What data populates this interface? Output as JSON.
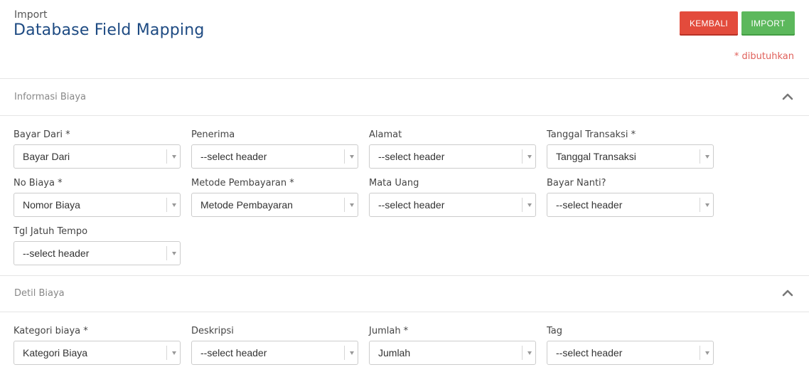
{
  "header": {
    "kicker": "Import",
    "title": "Database Field Mapping",
    "back_label": "KEMBALI",
    "import_label": "IMPORT",
    "required_note": "* dibutuhkan"
  },
  "sections": [
    {
      "title": "Informasi Biaya",
      "fields": [
        {
          "label": "Bayar Dari *",
          "value": "Bayar Dari"
        },
        {
          "label": "Penerima",
          "value": "--select header"
        },
        {
          "label": "Alamat",
          "value": "--select header"
        },
        {
          "label": "Tanggal Transaksi *",
          "value": "Tanggal Transaksi"
        },
        {
          "label": "No Biaya *",
          "value": "Nomor Biaya"
        },
        {
          "label": "Metode Pembayaran *",
          "value": "Metode Pembayaran"
        },
        {
          "label": "Mata Uang",
          "value": "--select header"
        },
        {
          "label": "Bayar Nanti?",
          "value": "--select header"
        },
        {
          "label": "Tgl Jatuh Tempo",
          "value": "--select header"
        }
      ]
    },
    {
      "title": "Detil Biaya",
      "fields": [
        {
          "label": "Kategori biaya *",
          "value": "Kategori Biaya"
        },
        {
          "label": "Deskripsi",
          "value": "--select header"
        },
        {
          "label": "Jumlah *",
          "value": "Jumlah"
        },
        {
          "label": "Tag",
          "value": "--select header"
        }
      ]
    }
  ],
  "icons": {
    "collapse": "chevron-up-icon",
    "dropdown": "caret-down-icon"
  },
  "colors": {
    "title": "#1d4a82",
    "back_button": "#e34b3c",
    "import_button": "#5cb85c",
    "required_note": "#e0605a"
  }
}
